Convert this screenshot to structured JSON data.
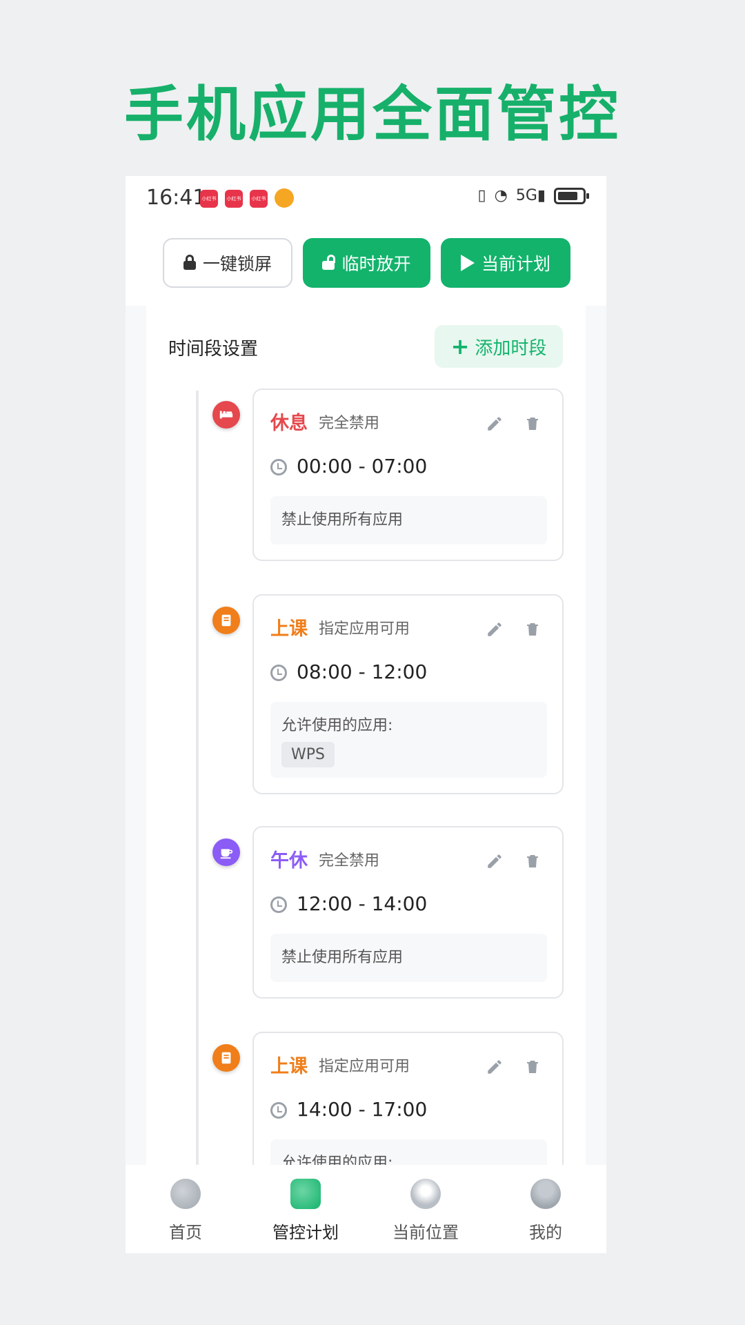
{
  "headline": "手机应用全面管控",
  "status": {
    "time": "16:41",
    "notif_label": "小红书",
    "signal": "5G"
  },
  "toolbar": {
    "lock_label": "一键锁屏",
    "open_label": "临时放开",
    "plan_label": "当前计划"
  },
  "panel": {
    "title": "时间段设置",
    "add_label": "添加时段"
  },
  "slots": [
    {
      "name": "休息",
      "mode": "完全禁用",
      "range": "00:00 - 07:00",
      "desc": "禁止使用所有应用",
      "color": "#e5484d",
      "icon": "bed-icon"
    },
    {
      "name": "上课",
      "mode": "指定应用可用",
      "range": "08:00 - 12:00",
      "desc": "允许使用的应用:",
      "apps": [
        "WPS"
      ],
      "color": "#f07e1a",
      "icon": "book-icon"
    },
    {
      "name": "午休",
      "mode": "完全禁用",
      "range": "12:00 - 14:00",
      "desc": "禁止使用所有应用",
      "color": "#8b5cf6",
      "icon": "coffee-icon"
    },
    {
      "name": "上课",
      "mode": "指定应用可用",
      "range": "14:00 - 17:00",
      "desc": "允许使用的应用:",
      "color": "#f07e1a",
      "icon": "book-icon"
    }
  ],
  "nav": [
    {
      "label": "首页",
      "icon": "home-icon"
    },
    {
      "label": "管控计划",
      "icon": "plan-icon"
    },
    {
      "label": "当前位置",
      "icon": "location-icon"
    },
    {
      "label": "我的",
      "icon": "user-icon"
    }
  ],
  "colors": {
    "brand": "#13b36c",
    "rest": "#e5484d",
    "class": "#f07e1a",
    "nap": "#8b5cf6"
  }
}
